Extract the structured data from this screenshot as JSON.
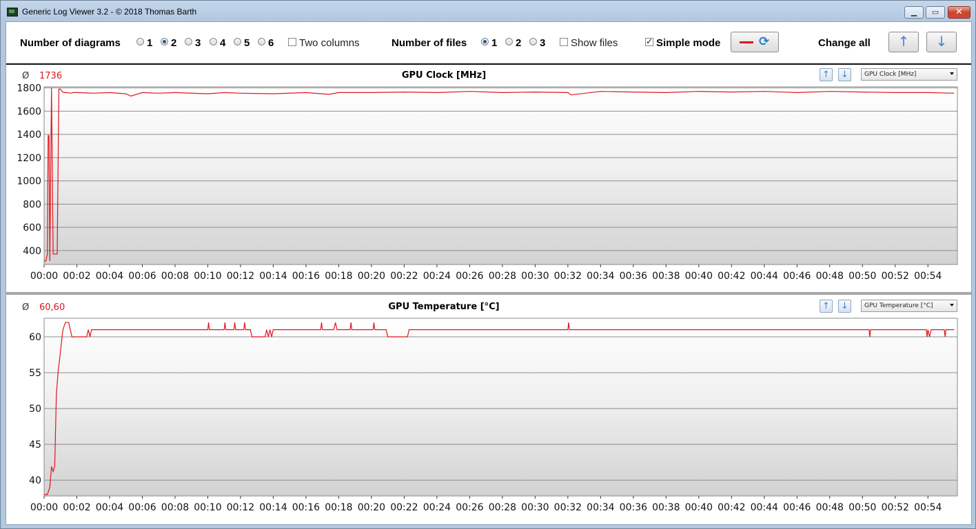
{
  "window": {
    "title": "Generic Log Viewer 3.2 - © 2018 Thomas Barth"
  },
  "toolbar": {
    "diagrams_label": "Number of diagrams",
    "diagram_options": [
      "1",
      "2",
      "3",
      "4",
      "5",
      "6"
    ],
    "diagrams_selected": "2",
    "two_columns_label": "Two columns",
    "two_columns_checked": false,
    "files_label": "Number of files",
    "file_options": [
      "1",
      "2",
      "3"
    ],
    "files_selected": "1",
    "show_files_label": "Show files",
    "show_files_checked": false,
    "simple_mode_label": "Simple mode",
    "simple_mode_checked": true,
    "change_all_label": "Change all",
    "line_color": "#e0141c"
  },
  "panels": [
    {
      "avg_symbol": "Ø",
      "avg_value": "1736",
      "title": "GPU Clock [MHz]",
      "select_value": "GPU Clock [MHz]"
    },
    {
      "avg_symbol": "Ø",
      "avg_value": "60,60",
      "title": "GPU Temperature [°C]",
      "select_value": "GPU Temperature [°C]"
    }
  ],
  "chart_data": [
    {
      "type": "line",
      "title": "GPU Clock [MHz]",
      "x_ticks": [
        "00:00",
        "00:02",
        "00:04",
        "00:06",
        "00:08",
        "00:10",
        "00:12",
        "00:14",
        "00:16",
        "00:18",
        "00:20",
        "00:22",
        "00:24",
        "00:26",
        "00:28",
        "00:30",
        "00:32",
        "00:34",
        "00:36",
        "00:38",
        "00:40",
        "00:42",
        "00:44",
        "00:46",
        "00:48",
        "00:50",
        "00:52",
        "00:54"
      ],
      "y_ticks": [
        400,
        600,
        800,
        1000,
        1200,
        1400,
        1600,
        1800
      ],
      "ylim": [
        280,
        1810
      ],
      "xlim_min": [
        0,
        55.8
      ],
      "grid": true,
      "series": [
        {
          "color": "#e0141c",
          "x": [
            0.0,
            0.1,
            0.2,
            0.25,
            0.3,
            0.35,
            0.45,
            0.55,
            0.6,
            0.7,
            0.8,
            0.9,
            1.0,
            1.1,
            1.2,
            1.4,
            1.6,
            1.8,
            2.0,
            3.0,
            4.0,
            5.0,
            5.3,
            6.0,
            7.0,
            8.0,
            10.0,
            11.0,
            12.0,
            14.0,
            16.0,
            17.4,
            18.0,
            20.0,
            22.0,
            24.0,
            26.0,
            28.0,
            30.0,
            32.0,
            32.2,
            34.0,
            36.0,
            38.0,
            40.0,
            42.0,
            44.0,
            46.0,
            48.0,
            50.0,
            52.0,
            54.0,
            55.6
          ],
          "y": [
            310,
            310,
            370,
            1390,
            1390,
            310,
            1800,
            370,
            370,
            370,
            370,
            1790,
            1790,
            1770,
            1760,
            1760,
            1755,
            1760,
            1760,
            1755,
            1760,
            1750,
            1730,
            1760,
            1755,
            1760,
            1750,
            1760,
            1755,
            1750,
            1760,
            1745,
            1760,
            1760,
            1765,
            1760,
            1770,
            1760,
            1765,
            1760,
            1740,
            1770,
            1765,
            1760,
            1770,
            1765,
            1770,
            1760,
            1770,
            1765,
            1760,
            1760,
            1755
          ]
        }
      ]
    },
    {
      "type": "line",
      "title": "GPU Temperature [°C]",
      "x_ticks": [
        "00:00",
        "00:02",
        "00:04",
        "00:06",
        "00:08",
        "00:10",
        "00:12",
        "00:14",
        "00:16",
        "00:18",
        "00:20",
        "00:22",
        "00:24",
        "00:26",
        "00:28",
        "00:30",
        "00:32",
        "00:34",
        "00:36",
        "00:38",
        "00:40",
        "00:42",
        "00:44",
        "00:46",
        "00:48",
        "00:50",
        "00:52",
        "00:54"
      ],
      "y_ticks": [
        40,
        45,
        50,
        55,
        60
      ],
      "ylim": [
        37.8,
        62.6
      ],
      "xlim_min": [
        0,
        55.8
      ],
      "grid": true,
      "series": [
        {
          "color": "#e0141c",
          "x": [
            0.0,
            0.2,
            0.35,
            0.45,
            0.55,
            0.65,
            0.75,
            0.85,
            0.95,
            1.05,
            1.15,
            1.3,
            1.5,
            1.6,
            1.7,
            1.9,
            2.0,
            2.6,
            2.7,
            2.8,
            2.9,
            3.0,
            4.0,
            9.0,
            10.0,
            10.05,
            10.1,
            11.0,
            11.05,
            11.1,
            11.6,
            11.65,
            11.7,
            12.2,
            12.25,
            12.3,
            12.6,
            12.7,
            13.5,
            13.6,
            13.7,
            13.8,
            13.9,
            14.0,
            15.0,
            16.9,
            16.95,
            17.0,
            17.7,
            17.8,
            17.9,
            18.7,
            18.75,
            18.8,
            20.1,
            20.15,
            20.2,
            20.9,
            21.0,
            22.2,
            22.3,
            23.0,
            32.0,
            32.05,
            32.1,
            33.0,
            50.4,
            50.45,
            50.5,
            53.9,
            53.95,
            54.0,
            54.1,
            54.2,
            55.0,
            55.05,
            55.1,
            55.6
          ],
          "y": [
            38,
            38,
            39,
            41.9,
            41.2,
            42,
            52,
            55,
            57,
            59,
            61,
            62,
            62,
            61,
            60,
            60,
            60,
            60,
            61,
            60,
            61,
            61,
            61,
            61,
            61,
            62,
            61,
            61,
            62,
            61,
            61,
            62,
            61,
            61,
            62,
            61,
            61,
            60,
            60,
            61,
            60,
            61,
            60,
            61,
            61,
            61,
            62,
            61,
            61,
            62,
            61,
            61,
            62,
            61,
            61,
            62,
            61,
            61,
            60,
            60,
            61,
            61,
            61,
            62,
            61,
            61,
            61,
            60,
            61,
            61,
            60,
            61,
            60,
            61,
            61,
            60,
            61,
            61
          ]
        }
      ]
    }
  ]
}
